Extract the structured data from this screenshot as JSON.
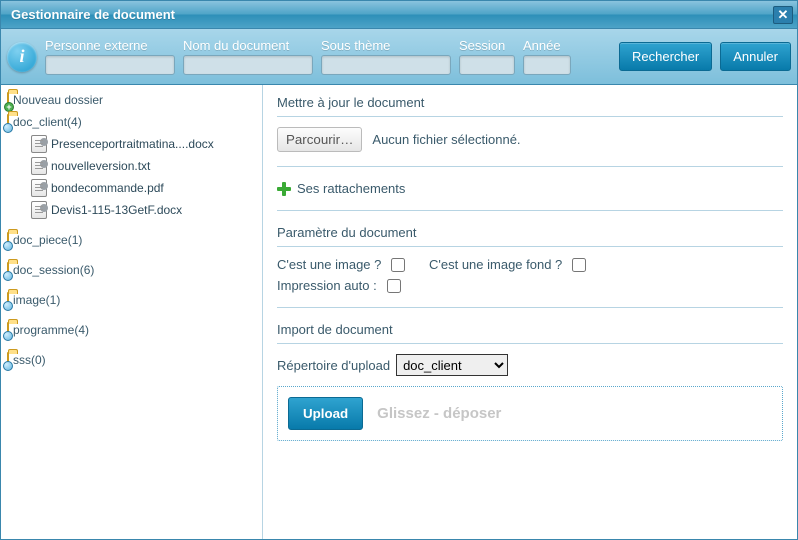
{
  "title": "Gestionnaire de document",
  "toolbar": {
    "person_label": "Personne externe",
    "docname_label": "Nom du document",
    "subtheme_label": "Sous thème",
    "session_label": "Session",
    "year_label": "Année",
    "search_label": "Rechercher",
    "cancel_label": "Annuler"
  },
  "tree": {
    "new_folder": "Nouveau dossier",
    "folders": [
      {
        "label": "doc_client(4)",
        "open": true,
        "files": [
          "Presenceportraitmatina....docx",
          "nouvelleversion.txt",
          "bondecommande.pdf",
          "Devis1-115-13GetF.docx"
        ]
      },
      {
        "label": "doc_piece(1)"
      },
      {
        "label": "doc_session(6)"
      },
      {
        "label": "image(1)"
      },
      {
        "label": "programme(4)"
      },
      {
        "label": "sss(0)"
      }
    ]
  },
  "panel": {
    "update_title": "Mettre à jour le document",
    "browse_label": "Parcourir…",
    "no_file": "Aucun fichier sélectionné.",
    "attachments_label": "Ses rattachements",
    "params_title": "Paramètre du document",
    "is_image_label": "C'est une image ?",
    "is_bg_image_label": "C'est une image fond ?",
    "auto_print_label": "Impression auto :",
    "import_title": "Import de document",
    "upload_dir_label": "Répertoire d'upload",
    "upload_dir_value": "doc_client",
    "upload_btn": "Upload",
    "drop_text": "Glissez - déposer"
  }
}
